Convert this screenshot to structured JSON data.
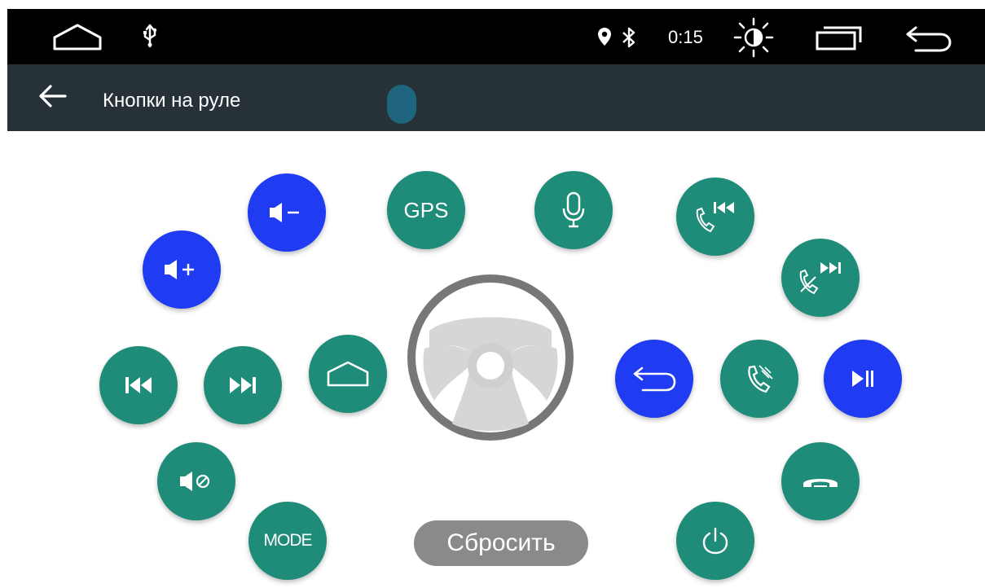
{
  "status_bar": {
    "time": "0:15",
    "icons": [
      "home-outline-icon",
      "usb-icon",
      "location-pin-icon",
      "bluetooth-icon",
      "brightness-icon",
      "recent-apps-icon",
      "back-icon"
    ]
  },
  "app_bar": {
    "title": "Кнопки на руле",
    "back_icon": "arrow-left-icon"
  },
  "buttons": {
    "gps_label": "GPS",
    "mode_label": "MODE",
    "icons": [
      "volume-down-icon",
      "volume-up-icon",
      "gps-icon",
      "microphone-icon",
      "call-prev-icon",
      "call-next-icon",
      "prev-track-icon",
      "next-track-icon",
      "home-icon",
      "back-icon",
      "phone-answer-icon",
      "play-pause-icon",
      "mute-icon",
      "mode-icon",
      "power-icon",
      "hang-up-icon"
    ]
  },
  "reset_label": "Сбросить",
  "colors": {
    "green": "#1e8c78",
    "blue": "#1f3cf2",
    "status_bar": "#000000",
    "app_bar": "#263238",
    "reset": "#8a8a8a"
  }
}
